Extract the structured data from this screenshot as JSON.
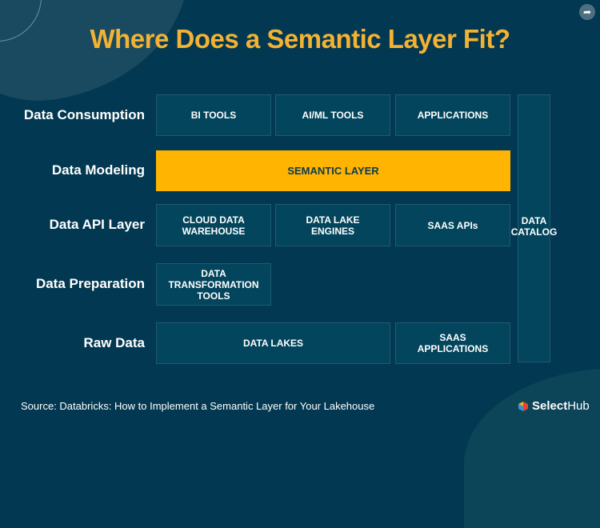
{
  "title": "Where Does a Semantic Layer Fit?",
  "share_icon": "share-arrow-icon",
  "rows": [
    {
      "label": "Data Consumption"
    },
    {
      "label": "Data Modeling"
    },
    {
      "label": "Data API Layer"
    },
    {
      "label": "Data Preparation"
    },
    {
      "label": "Raw Data"
    }
  ],
  "boxes": {
    "bi_tools": "BI TOOLS",
    "aiml_tools": "AI/ML TOOLS",
    "applications": "APPLICATIONS",
    "semantic_layer": "SEMANTIC LAYER",
    "cloud_dw_line1": "CLOUD DATA",
    "cloud_dw_line2": "WAREHOUSE",
    "lake_engines_line1": "DATA LAKE",
    "lake_engines_line2": "ENGINES",
    "saas_apis": "SAAS APIs",
    "transform_line1": "DATA",
    "transform_line2": "TRANSFORMATION",
    "transform_line3": "TOOLS",
    "data_lakes": "DATA LAKES",
    "saas_apps_line1": "SAAS",
    "saas_apps_line2": "APPLICATIONS",
    "catalog_line1": "DATA",
    "catalog_line2": "CATALOG"
  },
  "colors": {
    "background": "#023851",
    "title": "#f3b233",
    "box": "#02455c",
    "semantic": "#feb400"
  },
  "source": "Source: Databricks: How to Implement a Semantic Layer for Your Lakehouse",
  "logo": {
    "bold": "Select",
    "regular": "Hub"
  }
}
